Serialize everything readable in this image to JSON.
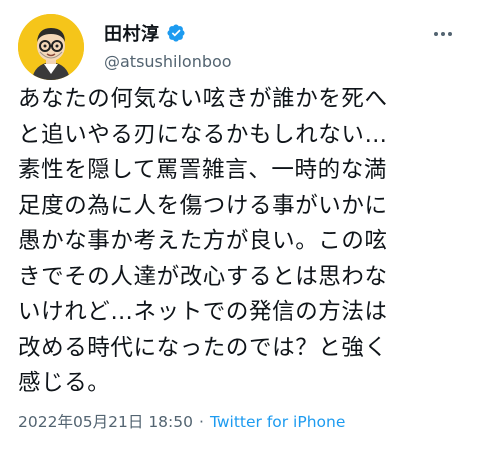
{
  "author": {
    "display_name": "田村淳",
    "handle": "@atsushilonboo",
    "verified": true,
    "avatar_icon": "cartoon-avatar-glasses"
  },
  "tweet": {
    "lines": [
      "あなたの何気ない呟きが誰かを死へ",
      "と追いやる刃になるかもしれない…",
      "素性を隠して罵詈雑言、一時的な満",
      "足度の為に人を傷つける事がいかに",
      "愚かな事か考えた方が良い。この呟",
      "きでその人達が改心するとは思わな",
      "いけれど…ネットでの発信の方法は",
      "改める時代になったのでは？と強く",
      "感じる。"
    ]
  },
  "meta": {
    "timestamp": "2022年05月21日 18:50",
    "separator": "·",
    "source": "Twitter for iPhone"
  },
  "colors": {
    "text": "#0f1419",
    "secondary": "#536471",
    "accent": "#1d9bf0",
    "avatar_bg": "#f5c51a"
  }
}
